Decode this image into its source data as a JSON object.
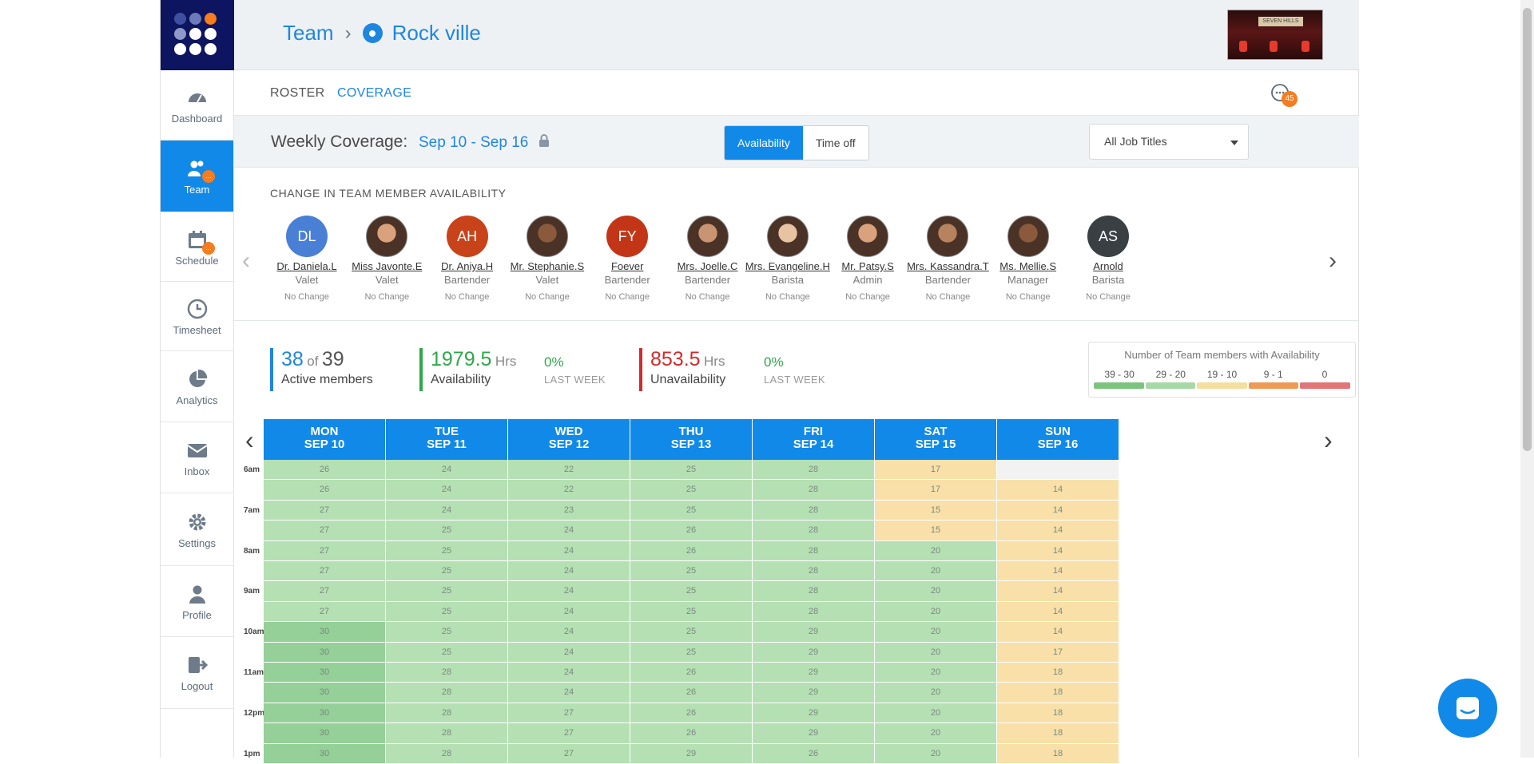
{
  "nav": {
    "items": [
      {
        "label": "Dashboard",
        "icon": "dashboard-icon"
      },
      {
        "label": "Team",
        "icon": "team-icon",
        "badge": "..."
      },
      {
        "label": "Schedule",
        "icon": "calendar-icon",
        "badge": "..."
      },
      {
        "label": "Timesheet",
        "icon": "clock-icon"
      },
      {
        "label": "Analytics",
        "icon": "pie-chart-icon"
      },
      {
        "label": "Inbox",
        "icon": "envelope-icon"
      },
      {
        "label": "Settings",
        "icon": "gear-icon"
      },
      {
        "label": "Profile",
        "icon": "person-icon"
      },
      {
        "label": "Logout",
        "icon": "logout-icon"
      }
    ]
  },
  "header": {
    "crumb_team": "Team",
    "crumb_location": "Rock ville",
    "venue_sign": "SEVEN HILLS"
  },
  "subnav": {
    "roster": "ROSTER",
    "coverage": "COVERAGE",
    "chat_count": "45"
  },
  "toolbar": {
    "title": "Weekly Coverage:",
    "range": "Sep 10 - Sep 16",
    "availability_btn": "Availability",
    "timeoff_btn": "Time off",
    "job_select": "All Job Titles"
  },
  "availability": {
    "label": "CHANGE IN TEAM MEMBER AVAILABILITY",
    "members": [
      {
        "initials": "DL",
        "name": "Dr. Daniela.L",
        "role": "Valet",
        "change": "No Change",
        "color": "#4a7fd6",
        "photo": false
      },
      {
        "initials": "",
        "name": "Miss Javonte.E",
        "role": "Valet",
        "change": "No Change",
        "color": "",
        "photo": true
      },
      {
        "initials": "AH",
        "name": "Dr. Aniya.H",
        "role": "Bartender",
        "change": "No Change",
        "color": "#c8421a",
        "photo": false
      },
      {
        "initials": "",
        "name": "Mr. Stephanie.S",
        "role": "Valet",
        "change": "No Change",
        "color": "",
        "photo": true
      },
      {
        "initials": "FY",
        "name": "Foever",
        "role": "Bartender",
        "change": "No Change",
        "color": "#c23617",
        "photo": false
      },
      {
        "initials": "",
        "name": "Mrs. Joelle.C",
        "role": "Bartender",
        "change": "No Change",
        "color": "",
        "photo": true
      },
      {
        "initials": "",
        "name": "Mrs. Evangeline.H",
        "role": "Barista",
        "change": "No Change",
        "color": "",
        "photo": true
      },
      {
        "initials": "",
        "name": "Mr. Patsy.S",
        "role": "Admin",
        "change": "No Change",
        "color": "",
        "photo": true
      },
      {
        "initials": "",
        "name": "Mrs. Kassandra.T",
        "role": "Bartender",
        "change": "No Change",
        "color": "",
        "photo": true
      },
      {
        "initials": "",
        "name": "Ms. Mellie.S",
        "role": "Manager",
        "change": "No Change",
        "color": "",
        "photo": true
      },
      {
        "initials": "AS",
        "name": "Arnold",
        "role": "Barista",
        "change": "No Change",
        "color": "#3a3f44",
        "photo": false
      }
    ]
  },
  "stats": {
    "active_count": "38",
    "active_of": "of",
    "active_total": "39",
    "active_label": "Active members",
    "avail_hours": "1979.5",
    "hrs": "Hrs",
    "avail_label": "Availability",
    "avail_pct": "0%",
    "last_week": "LAST WEEK",
    "unavail_hours": "853.5",
    "unavail_label": "Unavailability",
    "unavail_pct": "0%"
  },
  "legend": {
    "title": "Number of Team members with Availability",
    "ranges": [
      "39 - 30",
      "29 - 20",
      "19 - 10",
      "9 - 1",
      "0"
    ],
    "colors": [
      "#7cc47e",
      "#a6d9a6",
      "#f5dfa0",
      "#ee9b55",
      "#e27577"
    ]
  },
  "grid": {
    "days": [
      {
        "dow": "MON",
        "date": "SEP 10"
      },
      {
        "dow": "TUE",
        "date": "SEP 11"
      },
      {
        "dow": "WED",
        "date": "SEP 12"
      },
      {
        "dow": "THU",
        "date": "SEP 13"
      },
      {
        "dow": "FRI",
        "date": "SEP 14"
      },
      {
        "dow": "SAT",
        "date": "SEP 15"
      },
      {
        "dow": "SUN",
        "date": "SEP 16"
      }
    ],
    "time_labels": [
      "6am",
      "",
      "7am",
      "",
      "8am",
      "",
      "9am",
      "",
      "10am",
      "",
      "11am",
      "",
      "12pm",
      "",
      "1pm"
    ],
    "rows": [
      [
        "26",
        "24",
        "22",
        "25",
        "28",
        "17",
        ""
      ],
      [
        "26",
        "24",
        "22",
        "25",
        "28",
        "17",
        "14"
      ],
      [
        "27",
        "24",
        "23",
        "25",
        "28",
        "15",
        "14"
      ],
      [
        "27",
        "25",
        "24",
        "26",
        "28",
        "15",
        "14"
      ],
      [
        "27",
        "25",
        "24",
        "26",
        "28",
        "20",
        "14"
      ],
      [
        "27",
        "25",
        "24",
        "25",
        "28",
        "20",
        "14"
      ],
      [
        "27",
        "25",
        "24",
        "25",
        "28",
        "20",
        "14"
      ],
      [
        "27",
        "25",
        "24",
        "25",
        "28",
        "20",
        "14"
      ],
      [
        "30",
        "25",
        "24",
        "25",
        "29",
        "20",
        "14"
      ],
      [
        "30",
        "25",
        "24",
        "25",
        "29",
        "20",
        "17"
      ],
      [
        "30",
        "28",
        "24",
        "26",
        "29",
        "20",
        "18"
      ],
      [
        "30",
        "28",
        "24",
        "26",
        "29",
        "20",
        "18"
      ],
      [
        "30",
        "28",
        "27",
        "26",
        "29",
        "20",
        "18"
      ],
      [
        "30",
        "28",
        "27",
        "26",
        "29",
        "20",
        "18"
      ],
      [
        "30",
        "28",
        "27",
        "29",
        "26",
        "20",
        "18"
      ]
    ]
  }
}
